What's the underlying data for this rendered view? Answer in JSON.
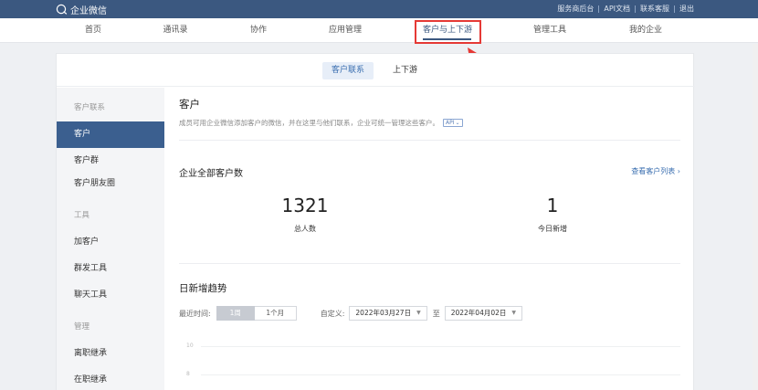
{
  "topbar": {
    "brand": "企业微信",
    "links": [
      "服务商后台",
      "API文档",
      "联系客服",
      "退出"
    ]
  },
  "nav": {
    "items": [
      {
        "label": "首页"
      },
      {
        "label": "通讯录"
      },
      {
        "label": "协作"
      },
      {
        "label": "应用管理"
      },
      {
        "label": "客户与上下游",
        "active": true
      },
      {
        "label": "管理工具"
      },
      {
        "label": "我的企业"
      }
    ]
  },
  "subtabs": {
    "active": "客户联系",
    "other": "上下游"
  },
  "sidebar": {
    "sections": [
      {
        "label": "客户联系",
        "items": [
          "客户",
          "客户群",
          "客户朋友圈"
        ]
      },
      {
        "label": "工具",
        "items": [
          "加客户",
          "群发工具",
          "聊天工具"
        ]
      },
      {
        "label": "管理",
        "items": [
          "离职继承",
          "在职继承"
        ]
      }
    ],
    "selected": "客户"
  },
  "main": {
    "title": "客户",
    "description": "成员可用企业微信添加客户的微信，并在这里与他们联系，企业可统一管理这些客户。",
    "api_badge": "API",
    "stats_title": "企业全部客户数",
    "view_list_link": "查看客户列表 ›",
    "stats": [
      {
        "value": "1321",
        "label": "总人数"
      },
      {
        "value": "1",
        "label": "今日新增"
      }
    ],
    "trend_title": "日新增趋势",
    "filter": {
      "recent_label": "最近时间:",
      "options": [
        "1周",
        "1个月"
      ],
      "active_option": "1周",
      "custom_label": "自定义:",
      "start_date": "2022年03月27日",
      "to": "至",
      "end_date": "2022年04月02日"
    },
    "chart_y_ticks": [
      "10",
      "8"
    ]
  },
  "colors": {
    "topbar_bg": "#3b5880",
    "selected_bg": "#3b5f8f",
    "link": "#3b6fb0",
    "highlight": "#e53935"
  }
}
